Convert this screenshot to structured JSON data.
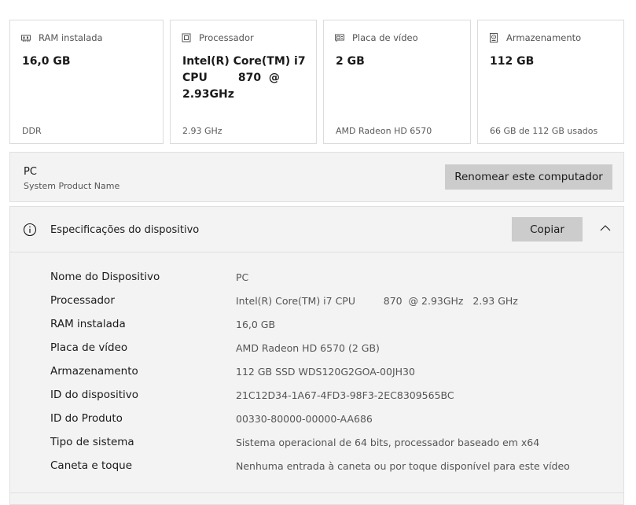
{
  "cards": [
    {
      "title": "RAM instalada",
      "value": "16,0 GB",
      "footer": "DDR",
      "icon": "memory-icon"
    },
    {
      "title": "Processador",
      "value": "Intel(R) Core(TM) i7\nCPU        870  @\n2.93GHz",
      "footer": "2.93 GHz",
      "icon": "cpu-icon"
    },
    {
      "title": "Placa de vídeo",
      "value": "2 GB",
      "footer": "AMD Radeon HD 6570",
      "icon": "gpu-icon"
    },
    {
      "title": "Armazenamento",
      "value": "112 GB",
      "footer": "66 GB de 112 GB usados",
      "icon": "storage-icon"
    }
  ],
  "device": {
    "name": "PC",
    "model": "System Product Name",
    "rename_label": "Renomear este computador"
  },
  "specs": {
    "title": "Especificações do dispositivo",
    "copy_label": "Copiar",
    "rows": [
      {
        "label": "Nome do Dispositivo",
        "value": "PC"
      },
      {
        "label": "Processador",
        "value": "Intel(R) Core(TM) i7 CPU         870  @ 2.93GHz   2.93 GHz"
      },
      {
        "label": "RAM instalada",
        "value": "16,0 GB"
      },
      {
        "label": "Placa de vídeo",
        "value": "AMD Radeon HD 6570 (2 GB)"
      },
      {
        "label": "Armazenamento",
        "value": "112 GB SSD WDS120G2GOA-00JH30"
      },
      {
        "label": "ID do dispositivo",
        "value": "21C12D34-1A67-4FD3-98F3-2EC8309565BC"
      },
      {
        "label": "ID do Produto",
        "value": "00330-80000-00000-AA686"
      },
      {
        "label": "Tipo de sistema",
        "value": "Sistema operacional de 64 bits, processador baseado em x64"
      },
      {
        "label": "Caneta e toque",
        "value": "Nenhuma entrada à caneta ou por toque disponível para este vídeo"
      }
    ]
  },
  "theme": {
    "panel_bg": "#f3f3f3",
    "button_bg": "#cccccc",
    "border": "#dcdcdc"
  }
}
